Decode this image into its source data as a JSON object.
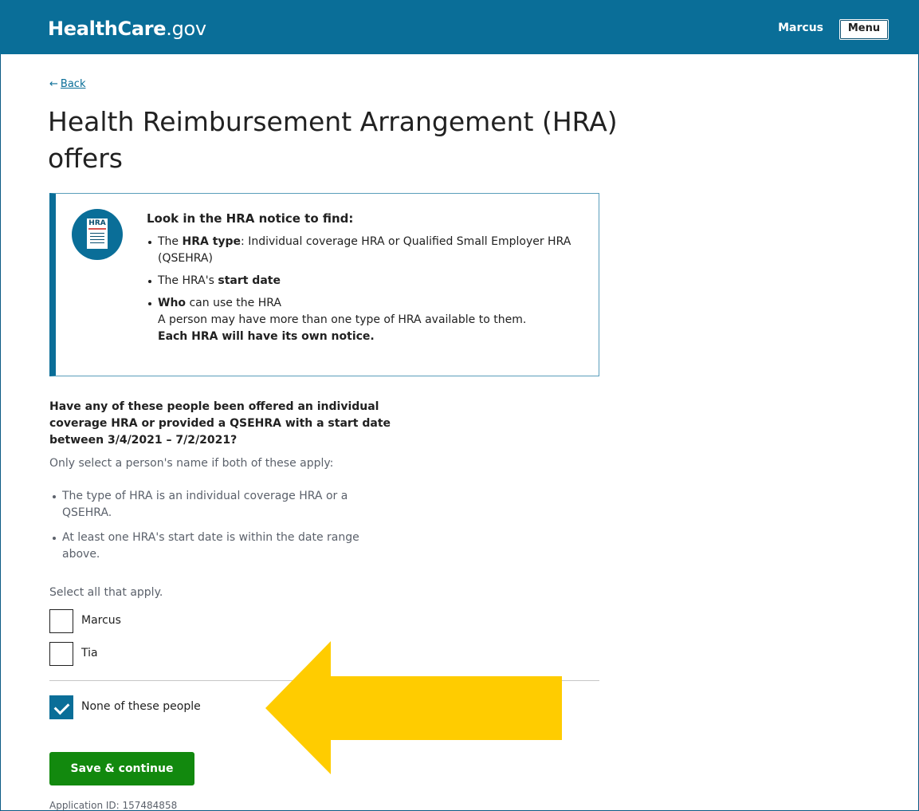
{
  "header": {
    "logo_brand": "HealthCare",
    "logo_tld": ".gov",
    "user_name": "Marcus",
    "menu_label": "Menu"
  },
  "back_link": "Back",
  "page_title": "Health Reimbursement Arrangement (HRA) offers",
  "notice": {
    "icon_label": "HRA",
    "title": "Look in the HRA notice to find:",
    "items": [
      {
        "pre": "The ",
        "bold": "HRA type",
        "post": ": Individual coverage HRA or Qualified Small Employer HRA (QSEHRA)"
      },
      {
        "pre": "The HRA's ",
        "bold": "start date",
        "post": ""
      },
      {
        "bold": "Who",
        "post": " can use the HRA",
        "extra": "A person may have more than one type of HRA available to them.",
        "extra_bold": "Each HRA will have its own notice."
      }
    ]
  },
  "question": "Have any of these people been offered an individual coverage HRA or provided a QSEHRA with a start date between 3/4/2021 – 7/2/2021?",
  "hint": "Only select a person's name if both of these apply:",
  "hint_items": [
    "The type of HRA is an individual coverage HRA or a QSEHRA.",
    "At least one HRA's start date is within the date range above."
  ],
  "select_all": "Select all that apply.",
  "options": [
    {
      "label": "Marcus",
      "checked": false
    },
    {
      "label": "Tia",
      "checked": false
    }
  ],
  "none_option": {
    "label": "None of these people",
    "checked": true
  },
  "annotation_arrow_color": "#ffcc00",
  "save_button": "Save & continue",
  "application_id": "Application ID: 157484858",
  "colors": {
    "header_bg": "#0a6e98",
    "primary_button": "#12890e",
    "link": "#0a6e98"
  }
}
